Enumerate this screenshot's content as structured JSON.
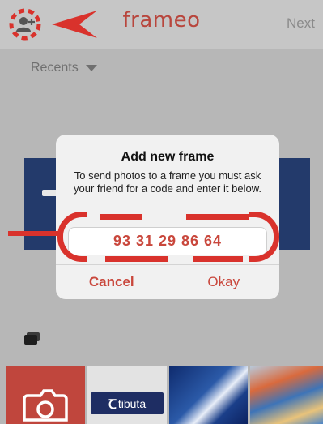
{
  "navbar": {
    "brand": "frameo",
    "next_label": "Next"
  },
  "recents": {
    "label": "Recents"
  },
  "dialog": {
    "title": "Add new frame",
    "message": "To send photos to a frame you must ask your friend for a code and enter it below.",
    "code_value": "93 31 29 86 64",
    "cancel_label": "Cancel",
    "okay_label": "Okay"
  },
  "gallery": {
    "tibuta_logo_text": "tibuta"
  },
  "colors": {
    "accent": "#c9473c",
    "annotation": "#d9322c",
    "navbar_bg": "#c6c6c6",
    "dialog_bg": "#f1f1f1"
  },
  "icons": [
    "add-friend-icon",
    "caret-down-icon",
    "photo-stack-icon",
    "camera-icon",
    "annotation-arrow-icon"
  ]
}
